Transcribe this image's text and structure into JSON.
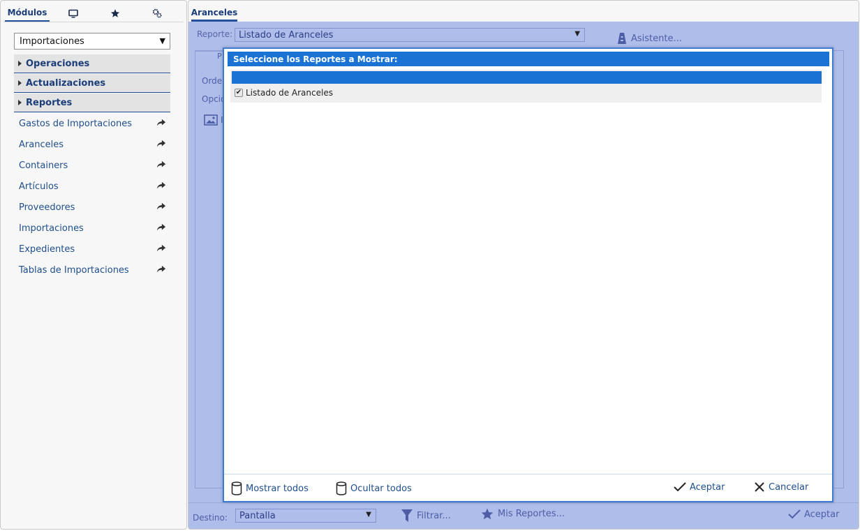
{
  "left_tabs": {
    "modulos": "Módulos",
    "monitor_icon": "monitor-icon",
    "favorites_icon": "star-icon",
    "config_icon": "settings-icon"
  },
  "module_select": {
    "value": "Importaciones"
  },
  "sections": [
    {
      "label": "Operaciones"
    },
    {
      "label": "Actualizaciones"
    },
    {
      "label": "Reportes"
    }
  ],
  "report_links": [
    {
      "label": "Gastos de Importaciones"
    },
    {
      "label": "Aranceles"
    },
    {
      "label": "Containers"
    },
    {
      "label": "Artículos"
    },
    {
      "label": "Proveedores"
    },
    {
      "label": "Importaciones"
    },
    {
      "label": "Expedientes"
    },
    {
      "label": "Tablas de Importaciones"
    }
  ],
  "right_tab": {
    "label": "Aranceles"
  },
  "report_form": {
    "report_label": "Reporte:",
    "report_value": "Listado de Aranceles",
    "asistente": "Asistente...",
    "tab_partial": "P",
    "orden_partial": "Orde",
    "opcion_partial": "Opció",
    "image_partial": "I"
  },
  "bottom_bar": {
    "destino_label": "Destino:",
    "destino_value": "Pantalla",
    "filtrar": "Filtrar...",
    "mis_reportes": "Mis Reportes...",
    "aceptar": "Aceptar"
  },
  "modal": {
    "title": "Seleccione los Reportes a Mostrar:",
    "items": [
      {
        "label": "Listado de Aranceles",
        "checked": true
      }
    ],
    "mostrar_todos": "Mostrar todos",
    "ocultar_todos": "Ocultar todos",
    "aceptar": "Aceptar",
    "cancelar": "Cancelar"
  },
  "colors": {
    "accent": "#1a73d4",
    "panel_bg": "#aebde9",
    "link": "#1f4e8c"
  }
}
